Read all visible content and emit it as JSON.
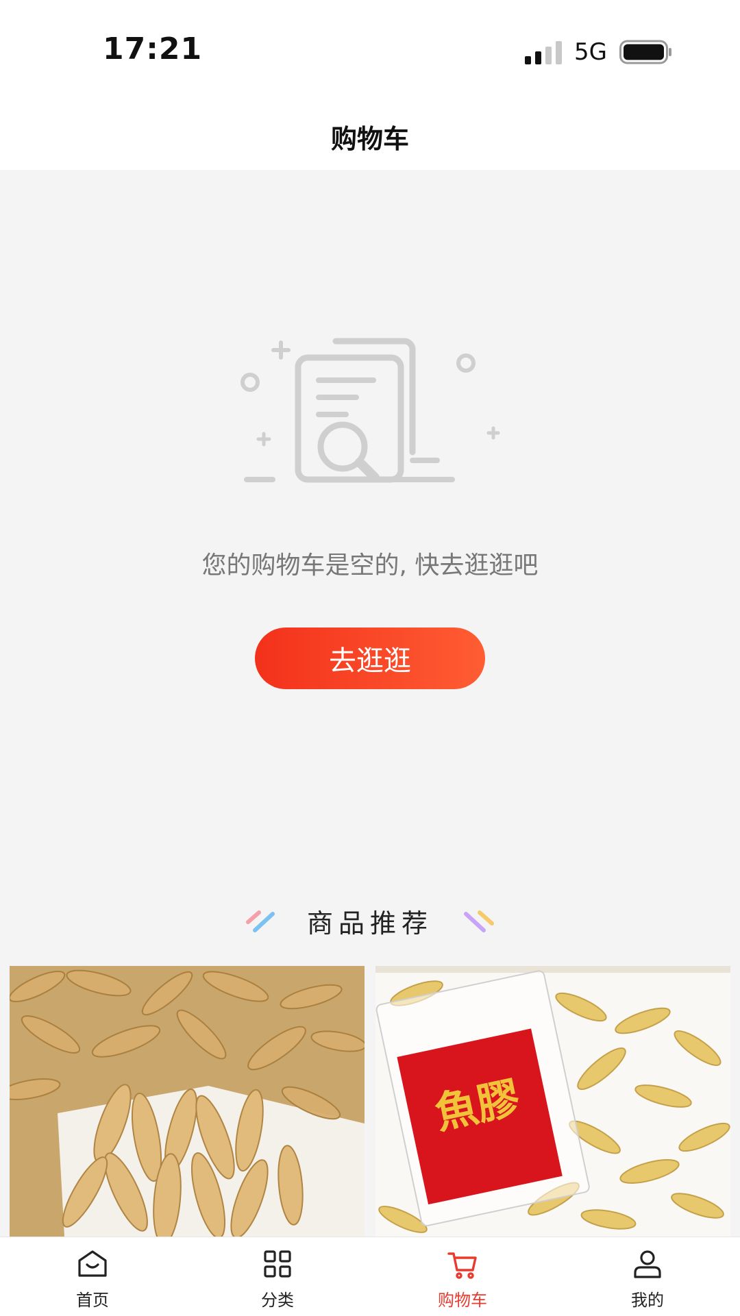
{
  "status_bar": {
    "time": "17:21",
    "network": "5G",
    "signal_icon": "cellular-signal-icon",
    "battery_icon": "battery-icon"
  },
  "header": {
    "title": "购物车"
  },
  "empty_state": {
    "icon": "empty-document-search-icon",
    "message": "您的购物车是空的, 快去逛逛吧",
    "button_label": "去逛逛"
  },
  "recommend": {
    "title": "商品推荐",
    "products": [
      {
        "image": "fish-maw-pile-image"
      },
      {
        "image": "fish-maw-packaged-image",
        "package_text": "魚膠"
      }
    ]
  },
  "tabbar": {
    "active_color": "#e83b2f",
    "items": [
      {
        "label": "首页",
        "icon": "home-icon"
      },
      {
        "label": "分类",
        "icon": "category-grid-icon"
      },
      {
        "label": "购物车",
        "icon": "cart-icon",
        "active": true
      },
      {
        "label": "我的",
        "icon": "user-icon"
      }
    ]
  }
}
